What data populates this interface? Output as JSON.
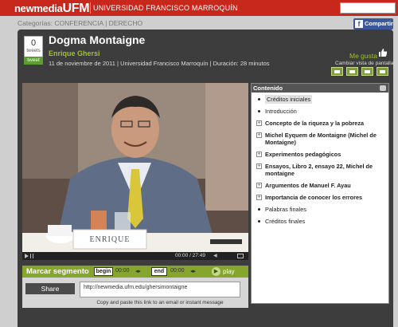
{
  "header": {
    "brand_prefix": "newmedia",
    "brand_main": "UFM",
    "university": "UNIVERSIDAD FRANCISCO MARROQUÍN",
    "colors": {
      "header_red": "#c8281c",
      "accent_green": "#9fc12e",
      "panel_dark": "#3d3d3d"
    }
  },
  "categories": {
    "label": "Categorías:",
    "items": "CONFERENCIA | DERECHO"
  },
  "facebook": {
    "icon": "f",
    "label": "Compartir"
  },
  "tweets": {
    "count": "0",
    "count_label": "tweets",
    "button": "tweet"
  },
  "video_info": {
    "title": "Dogma Montaigne",
    "author": "Enrique Ghersi",
    "meta": "11 de noviembre de 2011 | Universidad Francisco Marroquín | Duración: 28 minutos"
  },
  "like": {
    "label": "Me gusta",
    "icon": "thumbs-up-icon"
  },
  "view_switcher": {
    "label": "Cambiar vista de pantalla"
  },
  "player": {
    "nameplate": "ENRIQUE",
    "time": "00:00 / 27:49"
  },
  "contents": {
    "header": "Contenido",
    "items": [
      {
        "label": "Créditos iniciales",
        "type": "bullet",
        "active": true
      },
      {
        "label": "Introducción",
        "type": "bullet"
      },
      {
        "label": "Concepto de la riqueza y la pobreza",
        "type": "plus"
      },
      {
        "label": "Michel Eyquem de Montaigne (Michel de Montaigne)",
        "type": "plus"
      },
      {
        "label": "Experimentos pedagógicos",
        "type": "plus"
      },
      {
        "label": "Ensayos, Libro 2, ensayo 22, Michel de montaigne",
        "type": "plus"
      },
      {
        "label": "Argumentos de Manuel F. Ayau",
        "type": "plus"
      },
      {
        "label": "Importancia de conocer los errores",
        "type": "plus"
      },
      {
        "label": "Palabras finales",
        "type": "bullet"
      },
      {
        "label": "Créditos finales",
        "type": "bullet"
      }
    ]
  },
  "segment": {
    "title": "Marcar segmento",
    "begin_label": "begin",
    "begin_time": "00:00",
    "end_label": "end",
    "end_time": "00:00",
    "play_label": "play"
  },
  "share": {
    "button": "Share",
    "url": "http://newmedia.ufm.edu/ghersimontaigne",
    "hint": "Copy and paste this link to an email or instant message"
  }
}
